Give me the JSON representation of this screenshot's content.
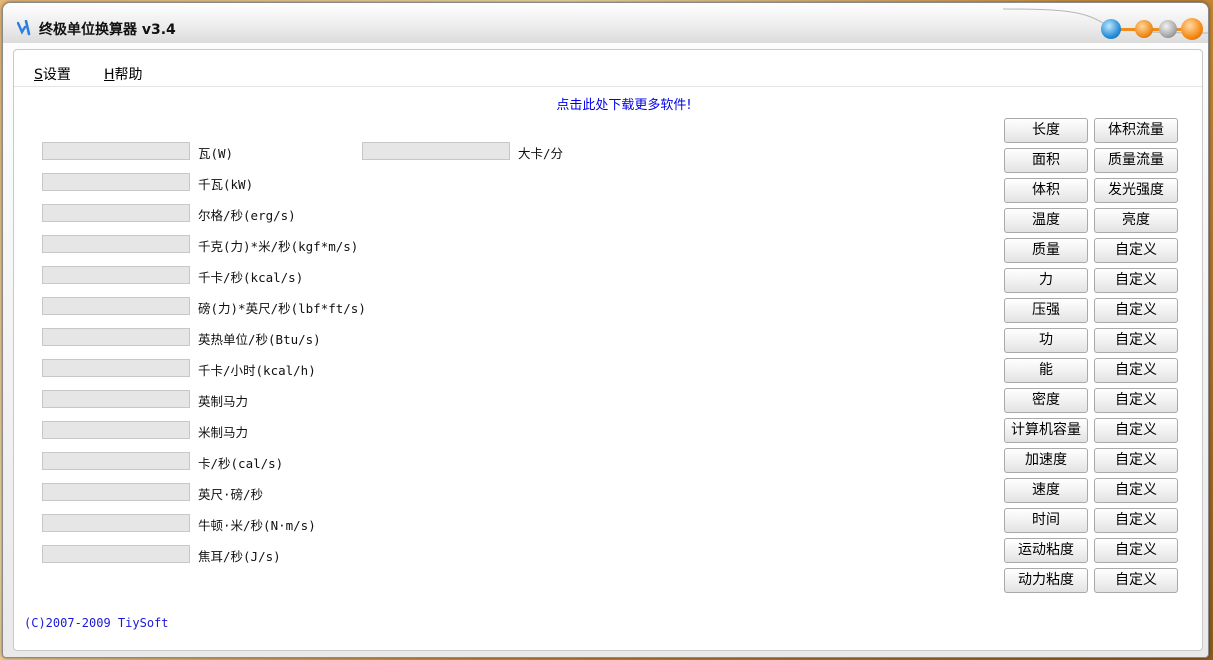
{
  "window": {
    "title": "终极单位换算器 v3.4"
  },
  "menu": [
    {
      "key": "S",
      "label": "设置"
    },
    {
      "key": "H",
      "label": "帮助"
    }
  ],
  "download_link": "点击此处下载更多软件!",
  "fields_left": [
    {
      "unit": "瓦(W)",
      "value": ""
    },
    {
      "unit": "千瓦(kW)",
      "value": ""
    },
    {
      "unit": "尔格/秒(erg/s)",
      "value": ""
    },
    {
      "unit": "千克(力)*米/秒(kgf*m/s)",
      "value": ""
    },
    {
      "unit": "千卡/秒(kcal/s)",
      "value": ""
    },
    {
      "unit": "磅(力)*英尺/秒(lbf*ft/s)",
      "value": ""
    },
    {
      "unit": "英热单位/秒(Btu/s)",
      "value": ""
    },
    {
      "unit": "千卡/小时(kcal/h)",
      "value": ""
    },
    {
      "unit": "英制马力",
      "value": ""
    },
    {
      "unit": "米制马力",
      "value": ""
    },
    {
      "unit": "卡/秒(cal/s)",
      "value": ""
    },
    {
      "unit": "英尺·磅/秒",
      "value": ""
    },
    {
      "unit": "牛顿·米/秒(N·m/s)",
      "value": ""
    },
    {
      "unit": "焦耳/秒(J/s)",
      "value": ""
    }
  ],
  "fields_right": [
    {
      "unit": "大卡/分",
      "value": ""
    }
  ],
  "category_buttons_left": [
    "长度",
    "面积",
    "体积",
    "温度",
    "质量",
    "力",
    "压强",
    "功",
    "能",
    "密度",
    "计算机容量",
    "加速度",
    "速度",
    "时间",
    "运动粘度",
    "动力粘度"
  ],
  "category_buttons_right": [
    "体积流量",
    "质量流量",
    "发光强度",
    "亮度",
    "自定义",
    "自定义",
    "自定义",
    "自定义",
    "自定义",
    "自定义",
    "自定义",
    "自定义",
    "自定义",
    "自定义",
    "自定义",
    "自定义"
  ],
  "copyright": "(C)2007-2009 TiySoft",
  "colors": {
    "link": "#0000ee",
    "copyright": "#1a1ad6",
    "accent_orange": "#f08c1a",
    "field_bg": "#e6e6e6"
  },
  "icons": {
    "app": "app-logo-icon",
    "skin": "skin-icon",
    "minimize": "minimize-icon",
    "maximize": "maximize-icon",
    "close": "close-icon"
  }
}
